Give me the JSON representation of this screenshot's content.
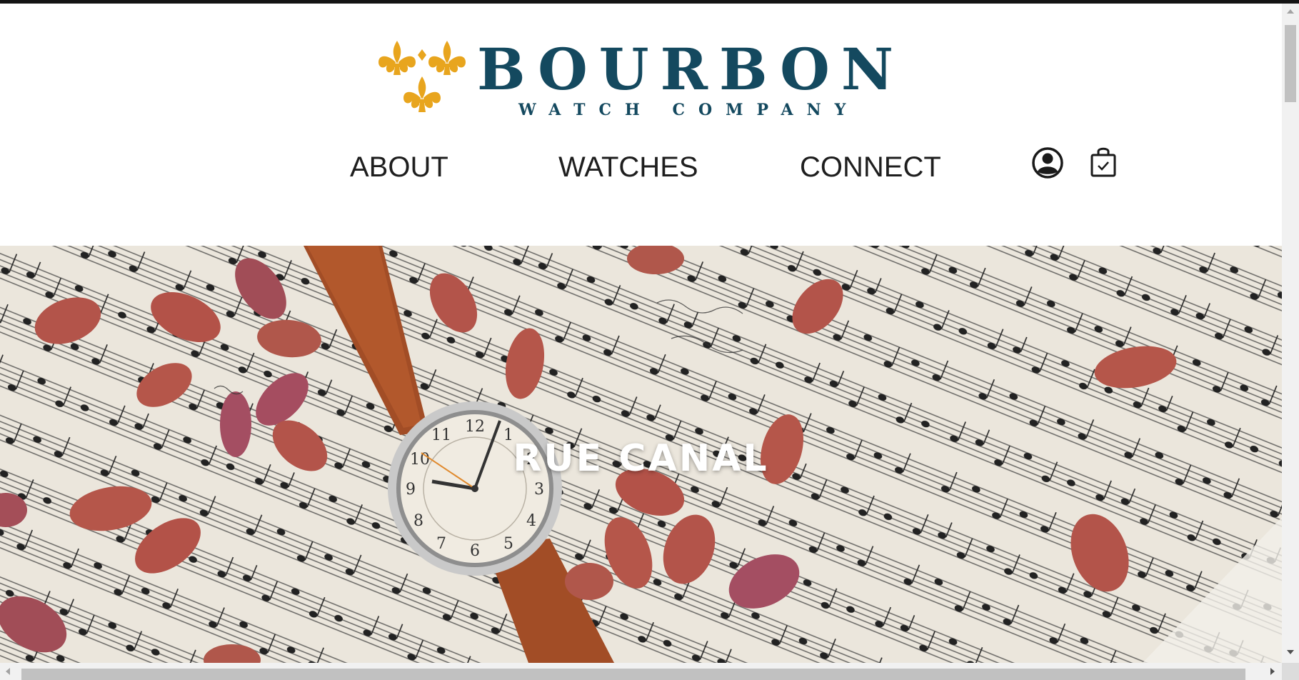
{
  "brand": {
    "name": "BOURBON",
    "subtitle": "WATCH COMPANY",
    "logo_icon": "fleur-de-lis-icon",
    "colors": {
      "wordmark": "#14495f",
      "emblem": "#e8a51e"
    }
  },
  "nav": {
    "items": [
      {
        "label": "ABOUT"
      },
      {
        "label": "WATCHES"
      },
      {
        "label": "CONNECT"
      }
    ],
    "icons": {
      "account": "user-circle-icon",
      "cart": "shopping-bag-icon"
    }
  },
  "hero": {
    "title": "RUE CANAL",
    "image": "watch-on-sheet-music-with-beans"
  }
}
